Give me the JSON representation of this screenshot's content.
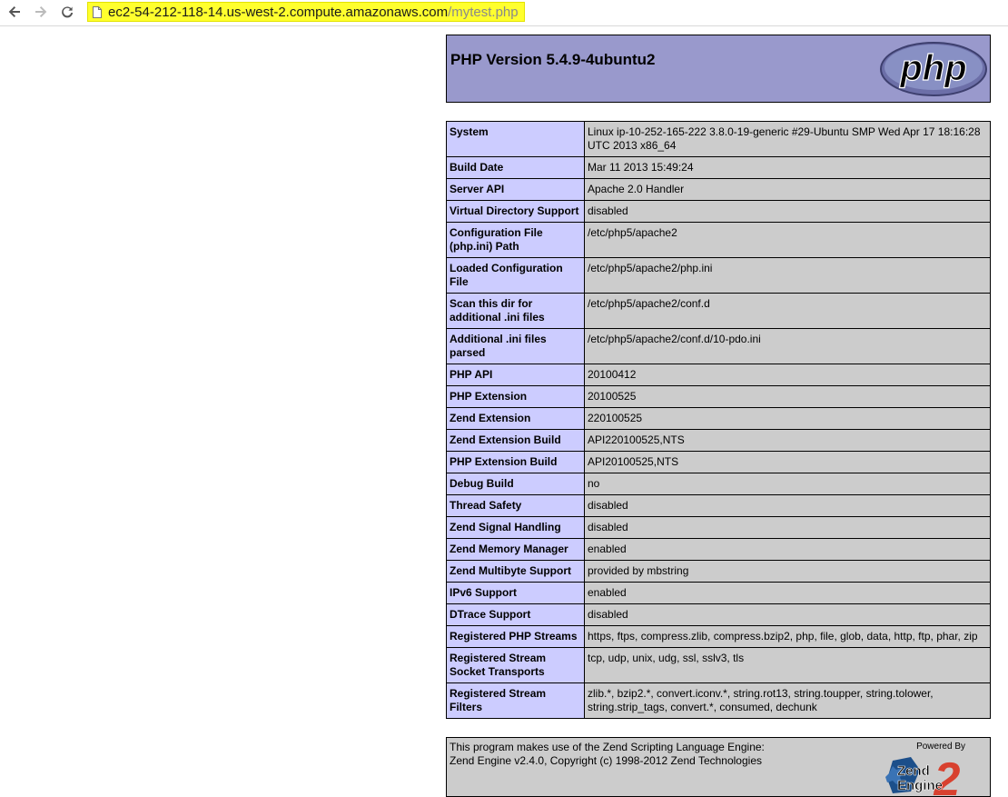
{
  "browser": {
    "url_host": "ec2-54-212-118-14.us-west-2.compute.amazonaws.com",
    "url_path": "/mytest.php",
    "highlight_color": "#ffff2e"
  },
  "header": {
    "title": "PHP Version 5.4.9-4ubuntu2",
    "logo_text": "php",
    "background": "#9999cc"
  },
  "info_rows": [
    {
      "key": "System",
      "value": "Linux ip-10-252-165-222 3.8.0-19-generic #29-Ubuntu SMP Wed Apr 17 18:16:28 UTC 2013 x86_64"
    },
    {
      "key": "Build Date",
      "value": "Mar 11 2013 15:49:24"
    },
    {
      "key": "Server API",
      "value": "Apache 2.0 Handler"
    },
    {
      "key": "Virtual Directory Support",
      "value": "disabled"
    },
    {
      "key": "Configuration File (php.ini) Path",
      "value": "/etc/php5/apache2"
    },
    {
      "key": "Loaded Configuration File",
      "value": "/etc/php5/apache2/php.ini"
    },
    {
      "key": "Scan this dir for additional .ini files",
      "value": "/etc/php5/apache2/conf.d"
    },
    {
      "key": "Additional .ini files parsed",
      "value": "/etc/php5/apache2/conf.d/10-pdo.ini"
    },
    {
      "key": "PHP API",
      "value": "20100412"
    },
    {
      "key": "PHP Extension",
      "value": "20100525"
    },
    {
      "key": "Zend Extension",
      "value": "220100525"
    },
    {
      "key": "Zend Extension Build",
      "value": "API220100525,NTS"
    },
    {
      "key": "PHP Extension Build",
      "value": "API20100525,NTS"
    },
    {
      "key": "Debug Build",
      "value": "no"
    },
    {
      "key": "Thread Safety",
      "value": "disabled"
    },
    {
      "key": "Zend Signal Handling",
      "value": "disabled"
    },
    {
      "key": "Zend Memory Manager",
      "value": "enabled"
    },
    {
      "key": "Zend Multibyte Support",
      "value": "provided by mbstring"
    },
    {
      "key": "IPv6 Support",
      "value": "enabled"
    },
    {
      "key": "DTrace Support",
      "value": "disabled"
    },
    {
      "key": "Registered PHP Streams",
      "value": "https, ftps, compress.zlib, compress.bzip2, php, file, glob, data, http, ftp, phar, zip"
    },
    {
      "key": "Registered Stream Socket Transports",
      "value": "tcp, udp, unix, udg, ssl, sslv3, tls"
    },
    {
      "key": "Registered Stream Filters",
      "value": "zlib.*, bzip2.*, convert.iconv.*, string.rot13, string.toupper, string.tolower, string.strip_tags, convert.*, consumed, dechunk"
    }
  ],
  "footer": {
    "line1": "This program makes use of the Zend Scripting Language Engine:",
    "line2": "Zend Engine v2.4.0, Copyright (c) 1998-2012 Zend Technologies",
    "powered_by": "Powered By",
    "zend_logo_line1": "Zend",
    "zend_logo_line2": "Engine",
    "zend_logo_number": "2"
  },
  "colors": {
    "key_cell": "#ccccff",
    "value_cell": "#cccccc"
  }
}
